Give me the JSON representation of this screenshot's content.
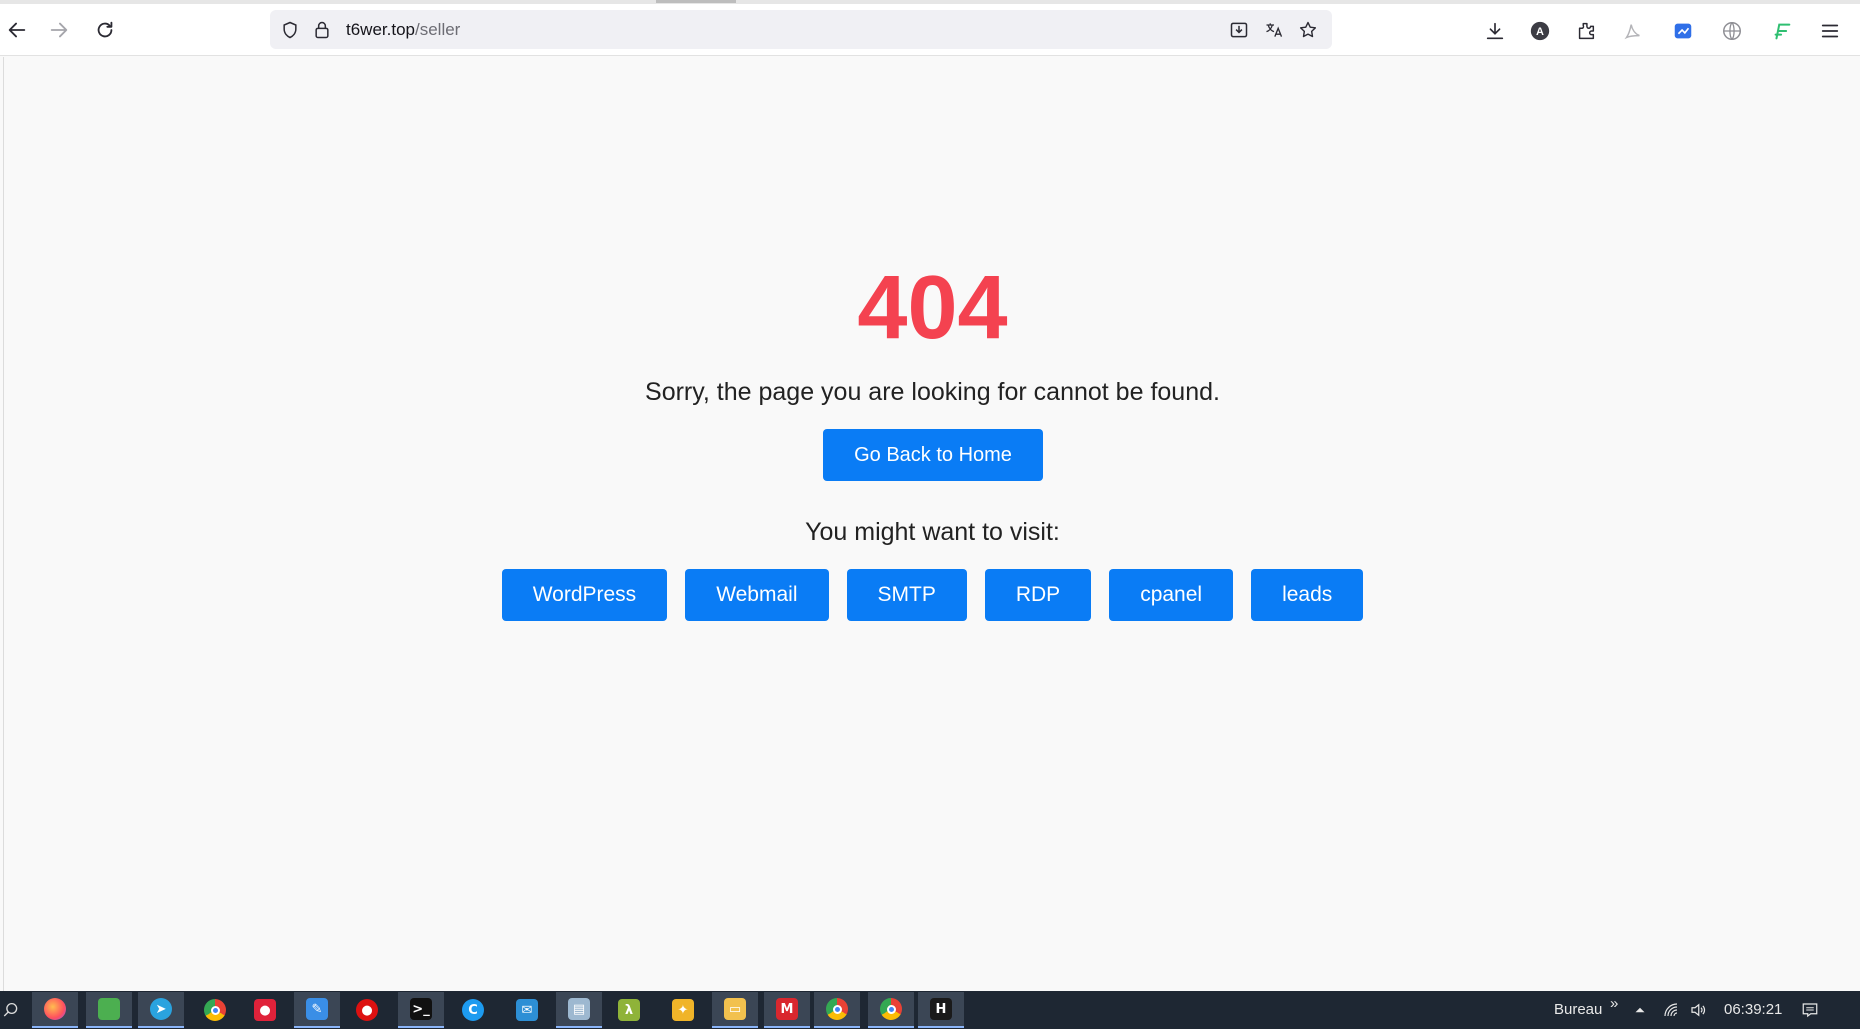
{
  "browser": {
    "url_host": "t6wer.top",
    "url_path": "/seller"
  },
  "page": {
    "error_code": "404",
    "message": "Sorry, the page you are looking for cannot be found.",
    "home_button": "Go Back to Home",
    "suggest_heading": "You might want to visit:",
    "links": [
      "WordPress",
      "Webmail",
      "SMTP",
      "RDP",
      "cpanel",
      "leads"
    ],
    "colors": {
      "error": "#f44250",
      "button": "#0a7cf5",
      "background": "#f9f9f9"
    }
  },
  "taskbar": {
    "apps": [
      {
        "name": "firefox-icon",
        "glyph": "",
        "color": "#ff7139",
        "active": true
      },
      {
        "name": "image-viewer-icon",
        "glyph": "",
        "color": "#4caf50",
        "active": true
      },
      {
        "name": "telegram-icon",
        "glyph": "➤",
        "color": "#2aa3df",
        "active": true
      },
      {
        "name": "chrome-icon",
        "glyph": "",
        "color": "#e94235",
        "active": false
      },
      {
        "name": "screen-recorder-icon",
        "glyph": "●",
        "color": "#e0223a",
        "active": false
      },
      {
        "name": "feather-app-icon",
        "glyph": "✎",
        "color": "#3a8ee6",
        "active": true
      },
      {
        "name": "record-icon",
        "glyph": "●",
        "color": "#d11",
        "active": false
      },
      {
        "name": "terminal-icon",
        "glyph": ">_",
        "color": "#111",
        "active": true
      },
      {
        "name": "ccleaner-icon",
        "glyph": "C",
        "color": "#1d9bf0",
        "active": false
      },
      {
        "name": "mail-client-icon",
        "glyph": "✉",
        "color": "#2d8fd5",
        "active": false
      },
      {
        "name": "notes-icon",
        "glyph": "▤",
        "color": "#9db8d0",
        "active": true
      },
      {
        "name": "lambda-app-icon",
        "glyph": "λ",
        "color": "#8fb339",
        "active": false
      },
      {
        "name": "brush-icon",
        "glyph": "✦",
        "color": "#f0b429",
        "active": false
      },
      {
        "name": "file-explorer-icon",
        "glyph": "▭",
        "color": "#f2c14e",
        "active": true
      },
      {
        "name": "mega-icon",
        "glyph": "M",
        "color": "#d9272e",
        "active": true
      },
      {
        "name": "chrome-profile-icon",
        "glyph": "",
        "color": "#e94235",
        "active": true
      },
      {
        "name": "chrome-alt-icon",
        "glyph": "",
        "color": "#e94235",
        "active": true
      },
      {
        "name": "h-app-icon",
        "glyph": "H",
        "color": "#1a1a1a",
        "active": true
      }
    ],
    "desktop_label": "Bureau",
    "chevron": "»",
    "clock": "06:39:21"
  }
}
